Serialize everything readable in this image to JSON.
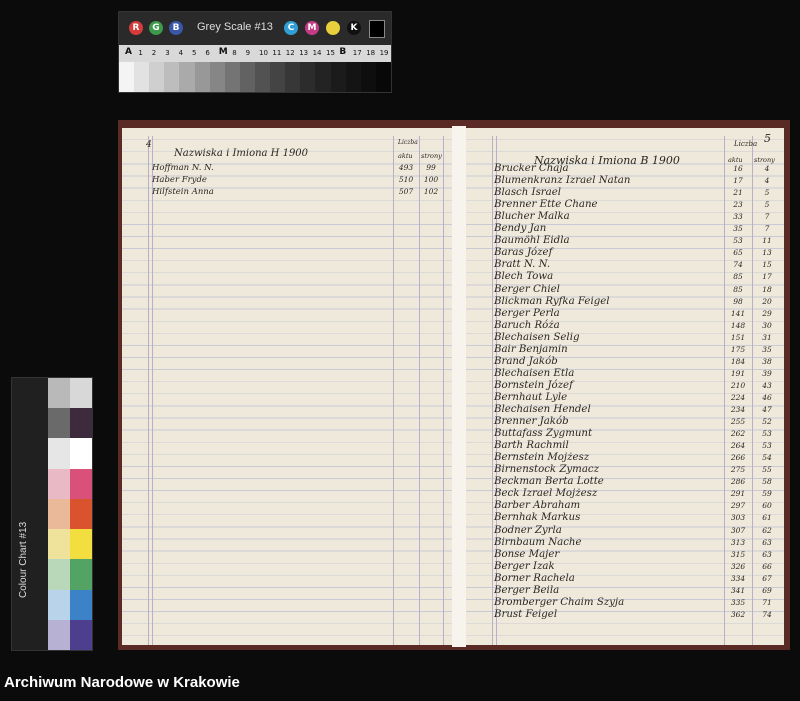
{
  "footer": {
    "archive_name": "Archiwum Narodowe w Krakowie"
  },
  "grey_scale_card": {
    "title": "Grey Scale #13",
    "dots": [
      {
        "letter": "R",
        "color": "#d63b3b"
      },
      {
        "letter": "G",
        "color": "#3e9a4a"
      },
      {
        "letter": "B",
        "color": "#3a56a8"
      },
      {
        "letter": "C",
        "color": "#2f9fd6"
      },
      {
        "letter": "M",
        "color": "#c63b86"
      },
      {
        "letter": "",
        "color": "#e8cf3c"
      },
      {
        "letter": "K",
        "color": "#111111"
      }
    ],
    "ruler": [
      "A",
      "1",
      "2",
      "3",
      "4",
      "5",
      "6",
      "M",
      "8",
      "9",
      "10",
      "11",
      "12",
      "13",
      "14",
      "15",
      "B",
      "17",
      "18",
      "19"
    ],
    "steps": [
      "#f4f4f4",
      "#e2e2e2",
      "#cfcfcf",
      "#bdbdbd",
      "#aaaaaa",
      "#989898",
      "#868686",
      "#747474",
      "#626262",
      "#525252",
      "#444444",
      "#373737",
      "#2c2c2c",
      "#232323",
      "#1b1b1b",
      "#141414",
      "#0e0e0e",
      "#080808"
    ]
  },
  "colour_chart": {
    "title": "Colour Chart #13",
    "swatches": [
      "#b9b9b9",
      "#d8d8d8",
      "#6a6a6a",
      "#3e2a3d",
      "#e6e6e6",
      "#ffffff",
      "#e9b9c6",
      "#d9507a",
      "#e9b99a",
      "#d9532f",
      "#efe29a",
      "#f2de3e",
      "#b9d8b9",
      "#52a364",
      "#b9d4ea",
      "#3c82c8",
      "#b7b2d3",
      "#4e3f8e"
    ]
  },
  "ledger": {
    "left": {
      "page_num": "4",
      "header": "Nazwiska i Imiona  H  1900",
      "col1_hdr": "aktu",
      "col2_hdr": "strony",
      "top_hdr": "Liczba",
      "rows": [
        {
          "name": "Hoffman N. N.",
          "a": "493",
          "s": "99"
        },
        {
          "name": "Haber Fryde",
          "a": "510",
          "s": "100"
        },
        {
          "name": "Hilfstein Anna",
          "a": "507",
          "s": "102"
        }
      ]
    },
    "right": {
      "page_num": "5",
      "header": "Nazwiska i Imiona  B  1900",
      "top_hdr": "Liczba",
      "col1_hdr": "aktu",
      "col2_hdr": "strony",
      "rows": [
        {
          "name": "Brucker Chaja",
          "a": "16",
          "s": "4"
        },
        {
          "name": "Blumenkranz Izrael Natan",
          "a": "17",
          "s": "4"
        },
        {
          "name": "Blasch Israel",
          "a": "21",
          "s": "5"
        },
        {
          "name": "Brenner Ette Chane",
          "a": "23",
          "s": "5"
        },
        {
          "name": "Blucher Malka",
          "a": "33",
          "s": "7"
        },
        {
          "name": "Bendy Jan",
          "a": "35",
          "s": "7"
        },
        {
          "name": "Baumöhl Eidla",
          "a": "53",
          "s": "11"
        },
        {
          "name": "Baras Józef",
          "a": "65",
          "s": "13"
        },
        {
          "name": "Bratt N. N.",
          "a": "74",
          "s": "15"
        },
        {
          "name": "Blech Towa",
          "a": "85",
          "s": "17"
        },
        {
          "name": "Berger Chiel",
          "a": "85",
          "s": "18"
        },
        {
          "name": "Blickman Ryfka Feigel",
          "a": "98",
          "s": "20"
        },
        {
          "name": "Berger Perla",
          "a": "141",
          "s": "29"
        },
        {
          "name": "Baruch Róża",
          "a": "148",
          "s": "30"
        },
        {
          "name": "Blechaisen Selig",
          "a": "151",
          "s": "31"
        },
        {
          "name": "Bair Benjamin",
          "a": "175",
          "s": "35"
        },
        {
          "name": "Brand Jakób",
          "a": "184",
          "s": "38"
        },
        {
          "name": "Blechaisen Etla",
          "a": "191",
          "s": "39"
        },
        {
          "name": "Bornstein Józef",
          "a": "210",
          "s": "43"
        },
        {
          "name": "Bernhaut Lyle",
          "a": "224",
          "s": "46"
        },
        {
          "name": "Blechaisen Hendel",
          "a": "234",
          "s": "47"
        },
        {
          "name": "Brenner Jakób",
          "a": "255",
          "s": "52"
        },
        {
          "name": "Buttafass Zygmunt",
          "a": "262",
          "s": "53"
        },
        {
          "name": "Barth Rachmil",
          "a": "264",
          "s": "53"
        },
        {
          "name": "Bernstein Mojżesz",
          "a": "266",
          "s": "54"
        },
        {
          "name": "Birnenstock Zymacz",
          "a": "275",
          "s": "55"
        },
        {
          "name": "Beckman Berta Lotte",
          "a": "286",
          "s": "58"
        },
        {
          "name": "Beck Izrael Mojżesz",
          "a": "291",
          "s": "59"
        },
        {
          "name": "Barber Abraham",
          "a": "297",
          "s": "60"
        },
        {
          "name": "Bernhak Markus",
          "a": "303",
          "s": "61"
        },
        {
          "name": "Bodner Zyrla",
          "a": "307",
          "s": "62"
        },
        {
          "name": "Birnbaum Nache",
          "a": "313",
          "s": "63"
        },
        {
          "name": "Bonse Majer",
          "a": "315",
          "s": "63"
        },
        {
          "name": "Berger Izak",
          "a": "326",
          "s": "66"
        },
        {
          "name": "Borner Rachela",
          "a": "334",
          "s": "67"
        },
        {
          "name": "Berger Beila",
          "a": "341",
          "s": "69"
        },
        {
          "name": "Bromberger Chaim Szyja",
          "a": "335",
          "s": "71"
        },
        {
          "name": "Brust Feigel",
          "a": "362",
          "s": "74"
        }
      ]
    }
  }
}
